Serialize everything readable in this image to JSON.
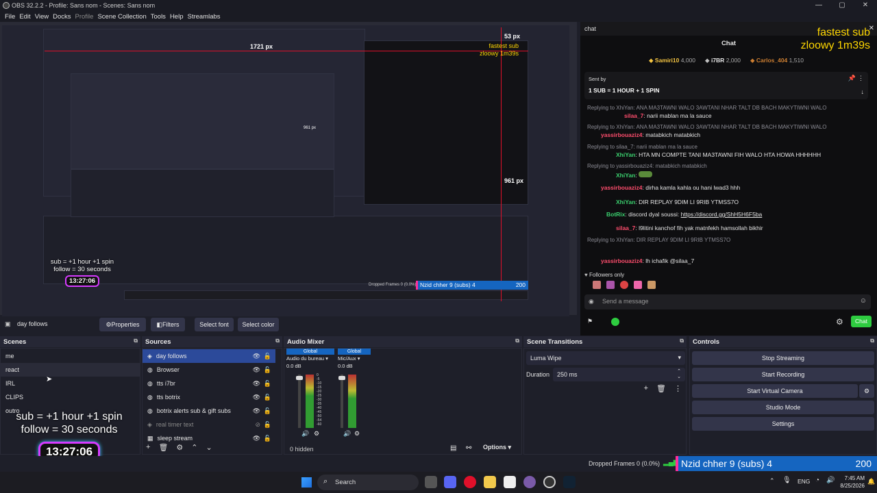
{
  "window": {
    "title": "OBS 32.2.2 - Profile: Sans nom - Scenes: Sans nom",
    "controls": [
      "—",
      "▢",
      "✕"
    ]
  },
  "menu": [
    "File",
    "Edit",
    "View",
    "Docks",
    "Profile",
    "Scene Collection",
    "Tools",
    "Help",
    "Streamlabs"
  ],
  "preview": {
    "measure_w": "1721 px",
    "measure_h1": "961 px",
    "measure_h2": "53 px",
    "measure_small": "961 px",
    "overlay_sub": "sub  = +1 hour +1 spin",
    "overlay_follow": "follow = 30 seconds",
    "overlay_timer": "13:27:06",
    "goal_text": "Nzid chher 9 (subs) 4",
    "goal_value": "200",
    "fastest_sub": "fastest sub",
    "fastest_name": "zloowy 1m39s",
    "inner_dropped": "Dropped Frames 0 (0.0%)"
  },
  "chat": {
    "dock_title": "chat",
    "header": "Chat",
    "fastest_sub": "fastest sub",
    "fastest_name": "zloowy 1m39s",
    "leaders": [
      {
        "name": "Samiri10",
        "score": "4,000"
      },
      {
        "name": "i7BR",
        "score": "2,000"
      },
      {
        "name": "Carlos_404",
        "score": "1,510"
      }
    ],
    "pinned_by": "Sent by",
    "pinned_text": "1 SUB = 1 HOUR + 1 SPIN",
    "lines": [
      {
        "reply": "Replying to XhiYan: ANA MA3TAWNI WALO 3AWTANI NHAR TALT DB BACH MAKYTIWNI WALO",
        "user": "silaa_7",
        "ucolor": "#ff4d6d",
        "text": "narii mablan ma la sauce"
      },
      {
        "reply": "Replying to XhiYan: ANA MA3TAWNI WALO 3AWTANI NHAR TALT DB BACH MAKYTIWNI WALO",
        "user": "yassirbouaziz4",
        "ucolor": "#ff4d6d",
        "text": "matabkich matabkich"
      },
      {
        "reply": "Replying to silaa_7: narii mablan ma la sauce",
        "user": "XhiYan",
        "ucolor": "#3bd16f",
        "text": "HTA MN COMPTE TANI MA3TAWNI FIH WALO HTA HOWA HHHHHH"
      },
      {
        "reply": "Replying to yassirbouaziz4: matabkich matabkich",
        "user": "XhiYan",
        "ucolor": "#3bd16f",
        "text": ""
      },
      {
        "reply": "",
        "user": "yassirbouaziz4",
        "ucolor": "#ff4d6d",
        "text": "dirha kamla kahla ou hani lwad3 hhh"
      },
      {
        "reply": "",
        "user": "XhiYan",
        "ucolor": "#3bd16f",
        "text": "DIR REPLAY 9DIM LI 9RIB YTMSS7O"
      },
      {
        "reply": "",
        "user": "BotRix",
        "ucolor": "#3bd16f",
        "text": "discord dyal soussi:",
        "link": "https://discord.gg/ShH5H6F5ba"
      },
      {
        "reply": "",
        "user": "silaa_7",
        "ucolor": "#ff4d6d",
        "text": "l9litini kanchof fih yak matnfekh hamsollah bikhir"
      },
      {
        "reply": "Replying to XhiYan: DIR REPLAY 9DIM LI 9RIB YTMSS7O",
        "user": "yassirbouaziz4",
        "ucolor": "#ff4d6d",
        "text": "lh ichafik @silaa_7"
      }
    ],
    "followers_only": "Followers only",
    "send_placeholder": "Send a message",
    "chat_button": "Chat"
  },
  "source_toolbar": {
    "current": "day follows",
    "properties": "Properties",
    "filters": "Filters",
    "select_font": "Select font",
    "select_color": "Select color"
  },
  "scenes": {
    "title": "Scenes",
    "items": [
      "me",
      "react",
      "IRL",
      "CLIPS",
      "outro"
    ],
    "overlay_sub": "sub  = +1 hour +1 spin",
    "overlay_follow": "follow = 30 seconds",
    "overlay_timer": "13:27:06"
  },
  "sources": {
    "title": "Sources",
    "items": [
      {
        "name": "day follows",
        "selected": true,
        "visible": true
      },
      {
        "name": "Browser",
        "selected": false,
        "visible": true
      },
      {
        "name": "tts i7br",
        "selected": false,
        "visible": true
      },
      {
        "name": "tts botrix",
        "selected": false,
        "visible": true
      },
      {
        "name": "botrix alerts sub & gift subs",
        "selected": false,
        "visible": true
      },
      {
        "name": "real timer text",
        "selected": false,
        "visible": false
      },
      {
        "name": "sleep stream",
        "selected": false,
        "visible": true
      }
    ]
  },
  "mixer": {
    "title": "Audio Mixer",
    "channels": [
      {
        "badge": "Global",
        "name": "Audio du bureau",
        "db": "0.0 dB",
        "level": 0.72
      },
      {
        "badge": "Global",
        "name": "Mic/Aux",
        "db": "0.0 dB",
        "level": 0.65
      }
    ],
    "scale": [
      "0",
      "-5",
      "-10",
      "-15",
      "-20",
      "-25",
      "-30",
      "-35",
      "-40",
      "-45",
      "-50",
      "-54",
      "-60"
    ],
    "hidden": "0 hidden",
    "options": "Options"
  },
  "transitions": {
    "title": "Scene Transitions",
    "current": "Luma Wipe",
    "duration_label": "Duration",
    "duration_value": "250 ms"
  },
  "controls": {
    "title": "Controls",
    "buttons": [
      "Stop Streaming",
      "Start Recording",
      "Start Virtual Camera",
      "Studio Mode",
      "Settings"
    ]
  },
  "statusbar": {
    "dropped": "Dropped Frames 0 (0.0%)",
    "goal_text": "Nzid chher 9 (subs) 4",
    "goal_value": "200"
  },
  "taskbar": {
    "search": "Search",
    "lang": "ENG",
    "time": "7:45 AM",
    "date": "8/25/2026"
  }
}
